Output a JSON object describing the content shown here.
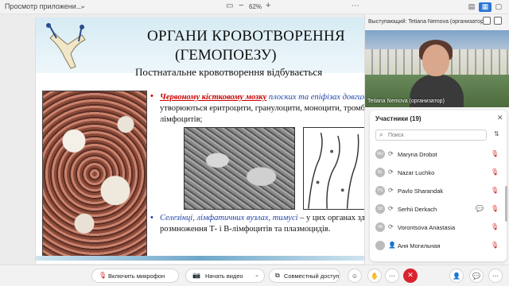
{
  "topbar": {
    "app_title": "Просмотр приложени...",
    "zoom": "62%"
  },
  "slide": {
    "title_line1": "ОРГАНИ КРОВОТВОРЕННЯ",
    "title_line2": "(ГЕМОПОЕЗУ)",
    "subtitle": "Постнатальне кровотворення відбувається",
    "bullet1_em": "Червоному кістковому мозку",
    "bullet1_rest": " плоских та епіфізах довгих",
    "bullet1_line2": "утворюються еритроцити, гранулоцити, моноцити, тромб",
    "bullet1_line3": "лімфоцитів;",
    "bullet2_em": "Селезінці, лімфатичних вузлах, тимусі",
    "bullet2_rest": " – у цих органах здійсн",
    "bullet2_line2": "розмноження Т- і В-лімфоцитів та плазмоцидів."
  },
  "speaker": {
    "label": "Выступающий: Tetiana Nemova (организатор)",
    "name_tag": "Tetiana Nemova (организатор)"
  },
  "participants": {
    "header": "Участники (19)",
    "search_placeholder": "Поиск",
    "rows": [
      {
        "initials": "MD",
        "name": "Maryna Drobot",
        "color": "#9aa6b2"
      },
      {
        "initials": "NL",
        "name": "Nazar Luchko",
        "color": "#9aa6b2"
      },
      {
        "initials": "PS",
        "name": "Pavlo Sharandak",
        "color": "#9aa6b2"
      },
      {
        "initials": "SD",
        "name": "Serhii Derkach",
        "color": "#9aa6b2"
      },
      {
        "initials": "VA",
        "name": "Vorontsova Anastasia",
        "color": "#9aa6b2"
      },
      {
        "initials": "",
        "name": "Аня Могильная",
        "color": "#9aa6b2"
      }
    ]
  },
  "toolbar": {
    "mic_label": "Включить микрофон",
    "video_label": "Начать видео",
    "share_label": "Совместный доступ"
  }
}
